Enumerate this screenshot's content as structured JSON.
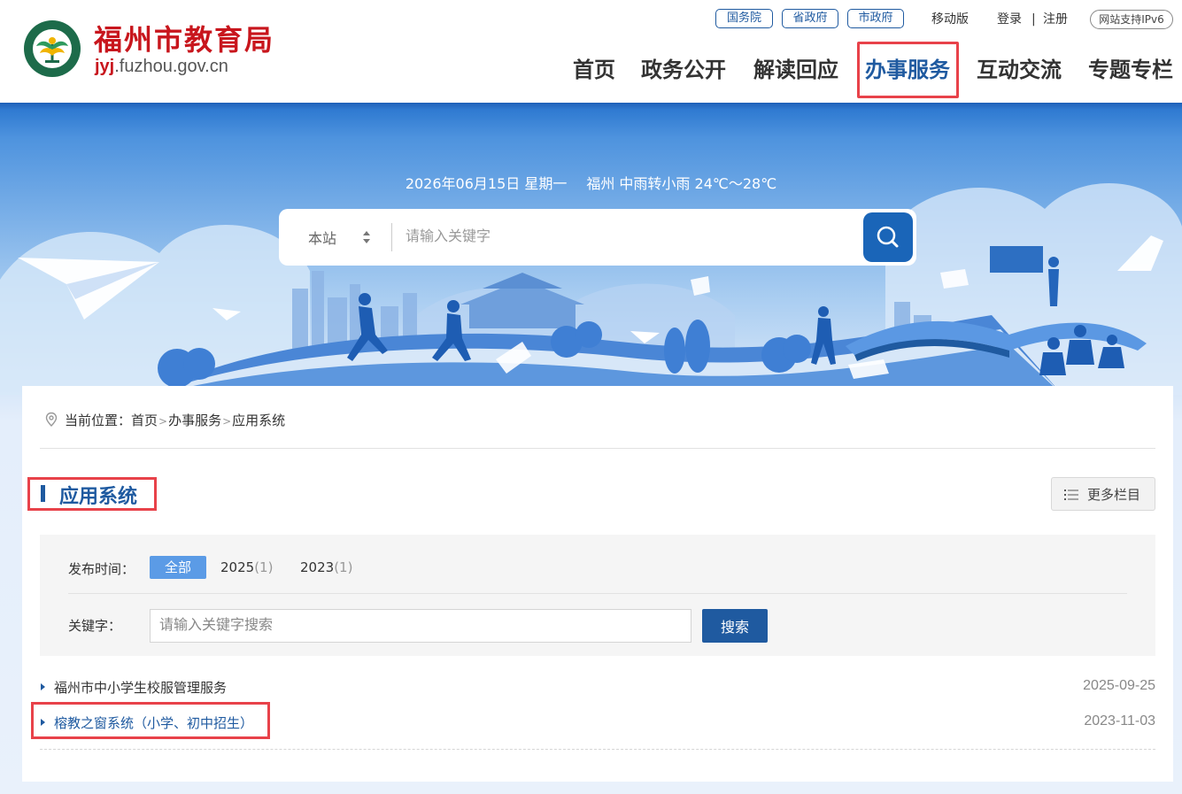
{
  "site": {
    "title": "福州市教育局",
    "domain_prefix": "jyj",
    "domain_rest": ".fuzhou.gov.cn",
    "brand_color": "#c8161d",
    "accent_color": "#1f5aa0",
    "logo_icon": "fuzhou-education-emblem-icon"
  },
  "toplinks": {
    "gov_links": [
      "国务院",
      "省政府",
      "市政府"
    ],
    "mobile": "移动版",
    "login": "登录",
    "separator": "|",
    "register": "注册",
    "ipv6": "网站支持IPv6"
  },
  "nav": {
    "items": [
      {
        "label": "首页",
        "active": false
      },
      {
        "label": "政务公开",
        "active": false
      },
      {
        "label": "解读回应",
        "active": false
      },
      {
        "label": "办事服务",
        "active": true
      },
      {
        "label": "互动交流",
        "active": false
      },
      {
        "label": "专题专栏",
        "active": false
      }
    ]
  },
  "banner": {
    "date": "2026年06月15日 星期一",
    "weather": "福州 中雨转小雨 24℃～28℃",
    "search": {
      "scope": "本站",
      "placeholder": "请输入关键字",
      "button_icon": "search-icon"
    }
  },
  "breadcrumb": {
    "prefix": "当前位置：",
    "items": [
      "首页",
      "办事服务",
      "应用系统"
    ],
    "separator": ">"
  },
  "section": {
    "title": "应用系统",
    "more_label": "更多栏目",
    "more_icon": "list-icon"
  },
  "filter": {
    "time_label": "发布时间：",
    "years": [
      {
        "label": "全部",
        "count": "",
        "active": true
      },
      {
        "label": "2025",
        "count": "(1)",
        "active": false
      },
      {
        "label": "2023",
        "count": "(1)",
        "active": false
      }
    ],
    "keyword_label": "关键字：",
    "keyword_placeholder": "请输入关键字搜索",
    "search_label": "搜索"
  },
  "list": [
    {
      "title": "福州市中小学生校服管理服务",
      "date": "2025-09-25"
    },
    {
      "title": "榕教之窗系统（小学、初中招生）",
      "date": "2023-11-03"
    }
  ]
}
